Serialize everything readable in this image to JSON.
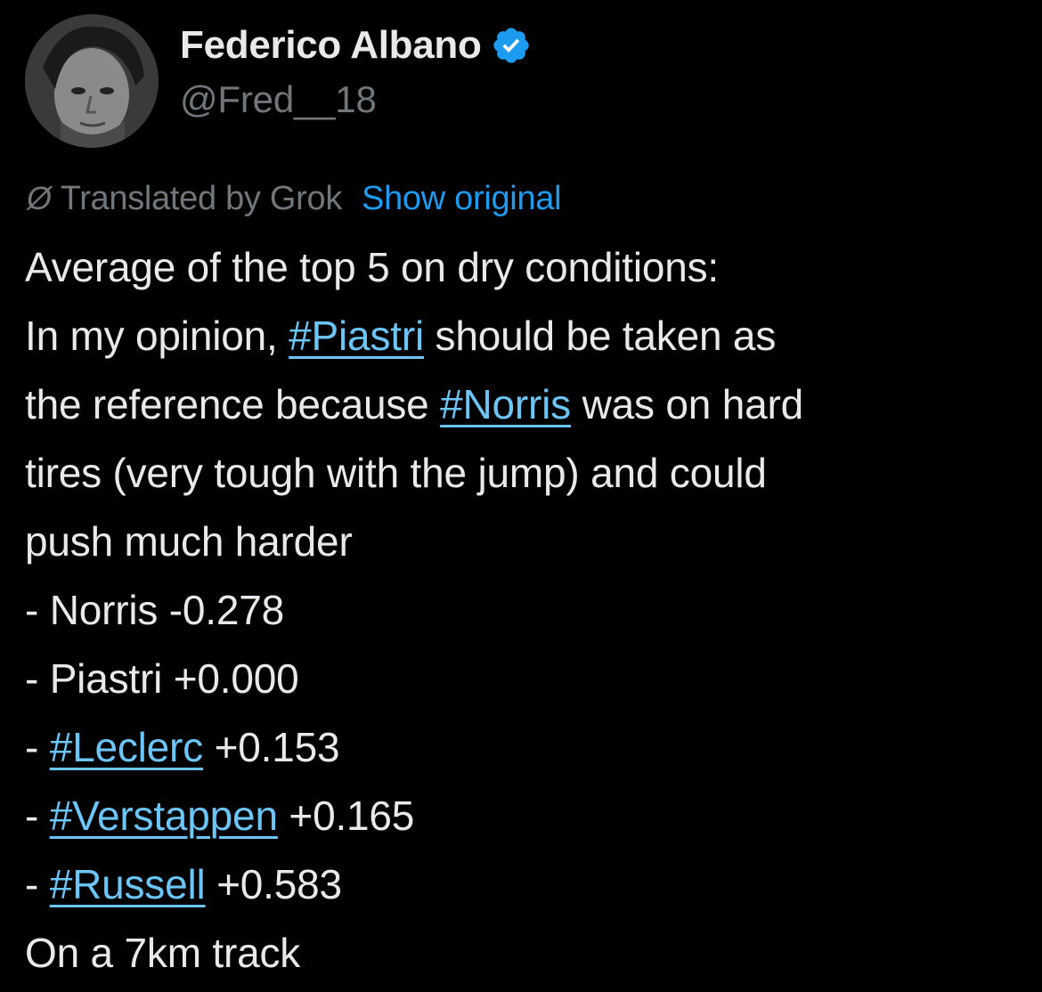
{
  "author": {
    "display_name": "Federico Albano",
    "handle": "@Fred__18",
    "verified": true,
    "avatar_icon": "profile-photo-icon",
    "verified_icon": "verified-badge-icon",
    "verified_color": "#1d9bf0"
  },
  "translation": {
    "icon": "translate-icon",
    "label": "Translated by Grok",
    "show_original": "Show original"
  },
  "tweet": {
    "line1": "Average of the top 5 on dry conditions:",
    "line2_prefix": "In my opinion, ",
    "line2_tag": "#Piastri",
    "line2_suffix": " should be taken as",
    "line3_prefix": "the reference because ",
    "line3_tag": "#Norris",
    "line3_suffix": " was on hard",
    "line4": "tires (very tough with the jump) and could",
    "line5": "push much harder",
    "results": [
      {
        "prefix": "- ",
        "tag": "",
        "name": "Norris",
        "gap": " -0.278"
      },
      {
        "prefix": "- ",
        "tag": "",
        "name": "Piastri",
        "gap": " +0.000"
      },
      {
        "prefix": "- ",
        "tag": "#Leclerc",
        "name": "",
        "gap": " +0.153"
      },
      {
        "prefix": "- ",
        "tag": "#Verstappen",
        "name": "",
        "gap": " +0.165"
      },
      {
        "prefix": "- ",
        "tag": "#Russell",
        "name": "",
        "gap": " +0.583"
      }
    ],
    "closing": "On a 7km track"
  },
  "colors": {
    "background": "#000000",
    "text": "#e7e9ea",
    "muted": "#71767b",
    "link": "#1d9bf0",
    "hashtag": "#6cc5f7"
  }
}
